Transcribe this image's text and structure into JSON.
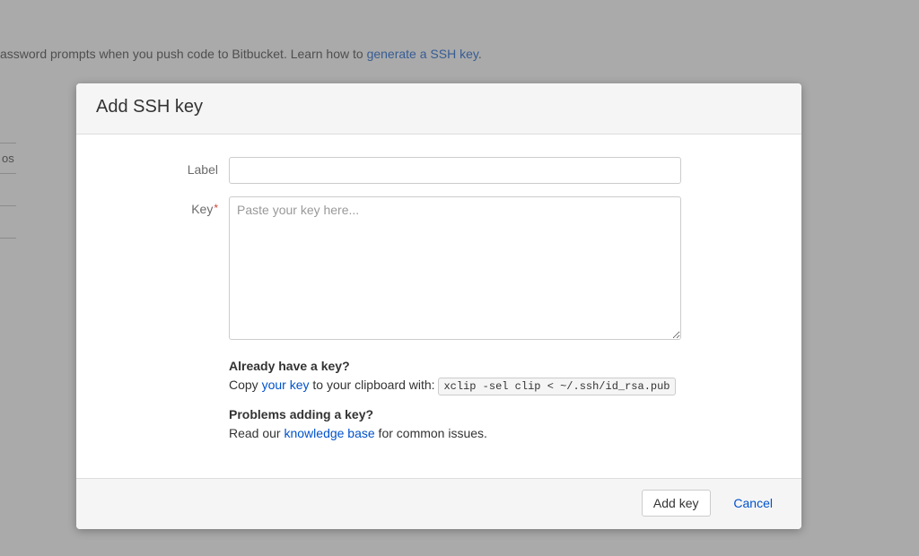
{
  "background": {
    "text_fragment": "assword prompts when you push code to Bitbucket. Learn how to ",
    "link_text": "generate a SSH key",
    "text_suffix": ".",
    "sidebar_item": "os"
  },
  "modal": {
    "title": "Add SSH key",
    "form": {
      "label_field": {
        "label": "Label",
        "value": ""
      },
      "key_field": {
        "label": "Key",
        "required_marker": "*",
        "placeholder": "Paste your key here...",
        "value": ""
      }
    },
    "help": {
      "already_have": {
        "heading": "Already have a key?",
        "text_prefix": "Copy ",
        "link": "your key",
        "text_mid": " to your clipboard with: ",
        "code": "xclip -sel clip < ~/.ssh/id_rsa.pub"
      },
      "problems": {
        "heading": "Problems adding a key?",
        "text_prefix": "Read our ",
        "link": "knowledge base",
        "text_suffix": " for common issues."
      }
    },
    "footer": {
      "submit": "Add key",
      "cancel": "Cancel"
    }
  }
}
